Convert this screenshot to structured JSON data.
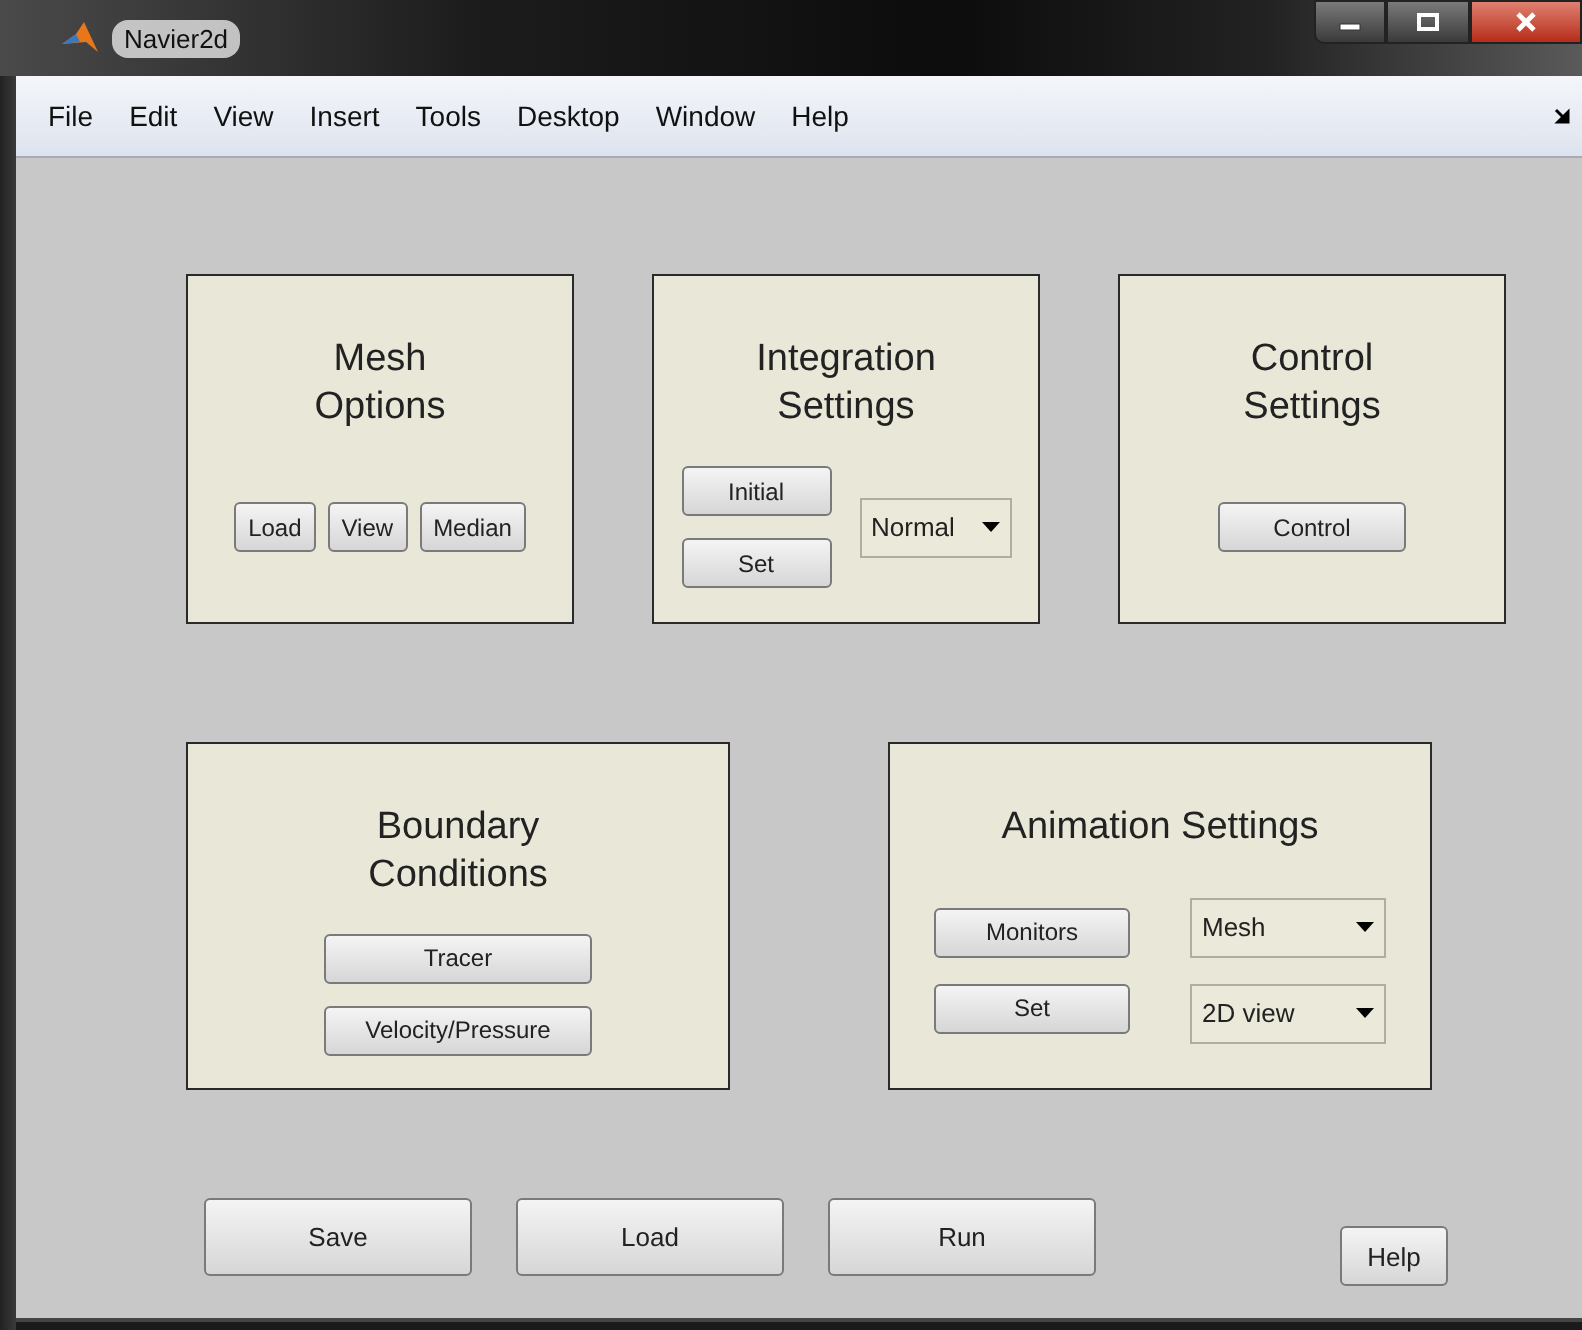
{
  "window": {
    "title": "Navier2d"
  },
  "menu": [
    "File",
    "Edit",
    "View",
    "Insert",
    "Tools",
    "Desktop",
    "Window",
    "Help"
  ],
  "panel_rows": [
    [
      {
        "title_lines": [
          "Mesh",
          "Options"
        ],
        "columns": [
          [
            {
              "kind": "button",
              "label": "Load"
            }
          ],
          [
            {
              "kind": "button",
              "label": "View"
            }
          ],
          [
            {
              "kind": "button",
              "label": "Median"
            }
          ]
        ]
      },
      {
        "title_lines": [
          "Integration",
          "Settings"
        ],
        "columns": [
          [
            {
              "kind": "button",
              "label": "Initial"
            },
            {
              "kind": "button",
              "label": "Set"
            }
          ],
          [
            {
              "kind": "dropdown",
              "value": "Normal"
            }
          ]
        ]
      },
      {
        "title_lines": [
          "Control",
          "Settings"
        ],
        "columns": [
          [
            {
              "kind": "button",
              "label": "Control"
            }
          ]
        ]
      }
    ],
    [
      {
        "title_lines": [
          "Boundary",
          "Conditions"
        ],
        "columns": [
          [
            {
              "kind": "button",
              "label": "Tracer"
            },
            {
              "kind": "button",
              "label": "Velocity/Pressure"
            }
          ]
        ]
      },
      {
        "title_lines": [
          "Animation Settings"
        ],
        "columns": [
          [
            {
              "kind": "button",
              "label": "Monitors"
            },
            {
              "kind": "button",
              "label": "Set"
            }
          ],
          [
            {
              "kind": "dropdown",
              "value": "Mesh"
            },
            {
              "kind": "dropdown",
              "value": "2D view"
            }
          ]
        ]
      }
    ]
  ],
  "bottom_buttons": [
    "Save",
    "Load",
    "Run"
  ],
  "help_button": "Help"
}
